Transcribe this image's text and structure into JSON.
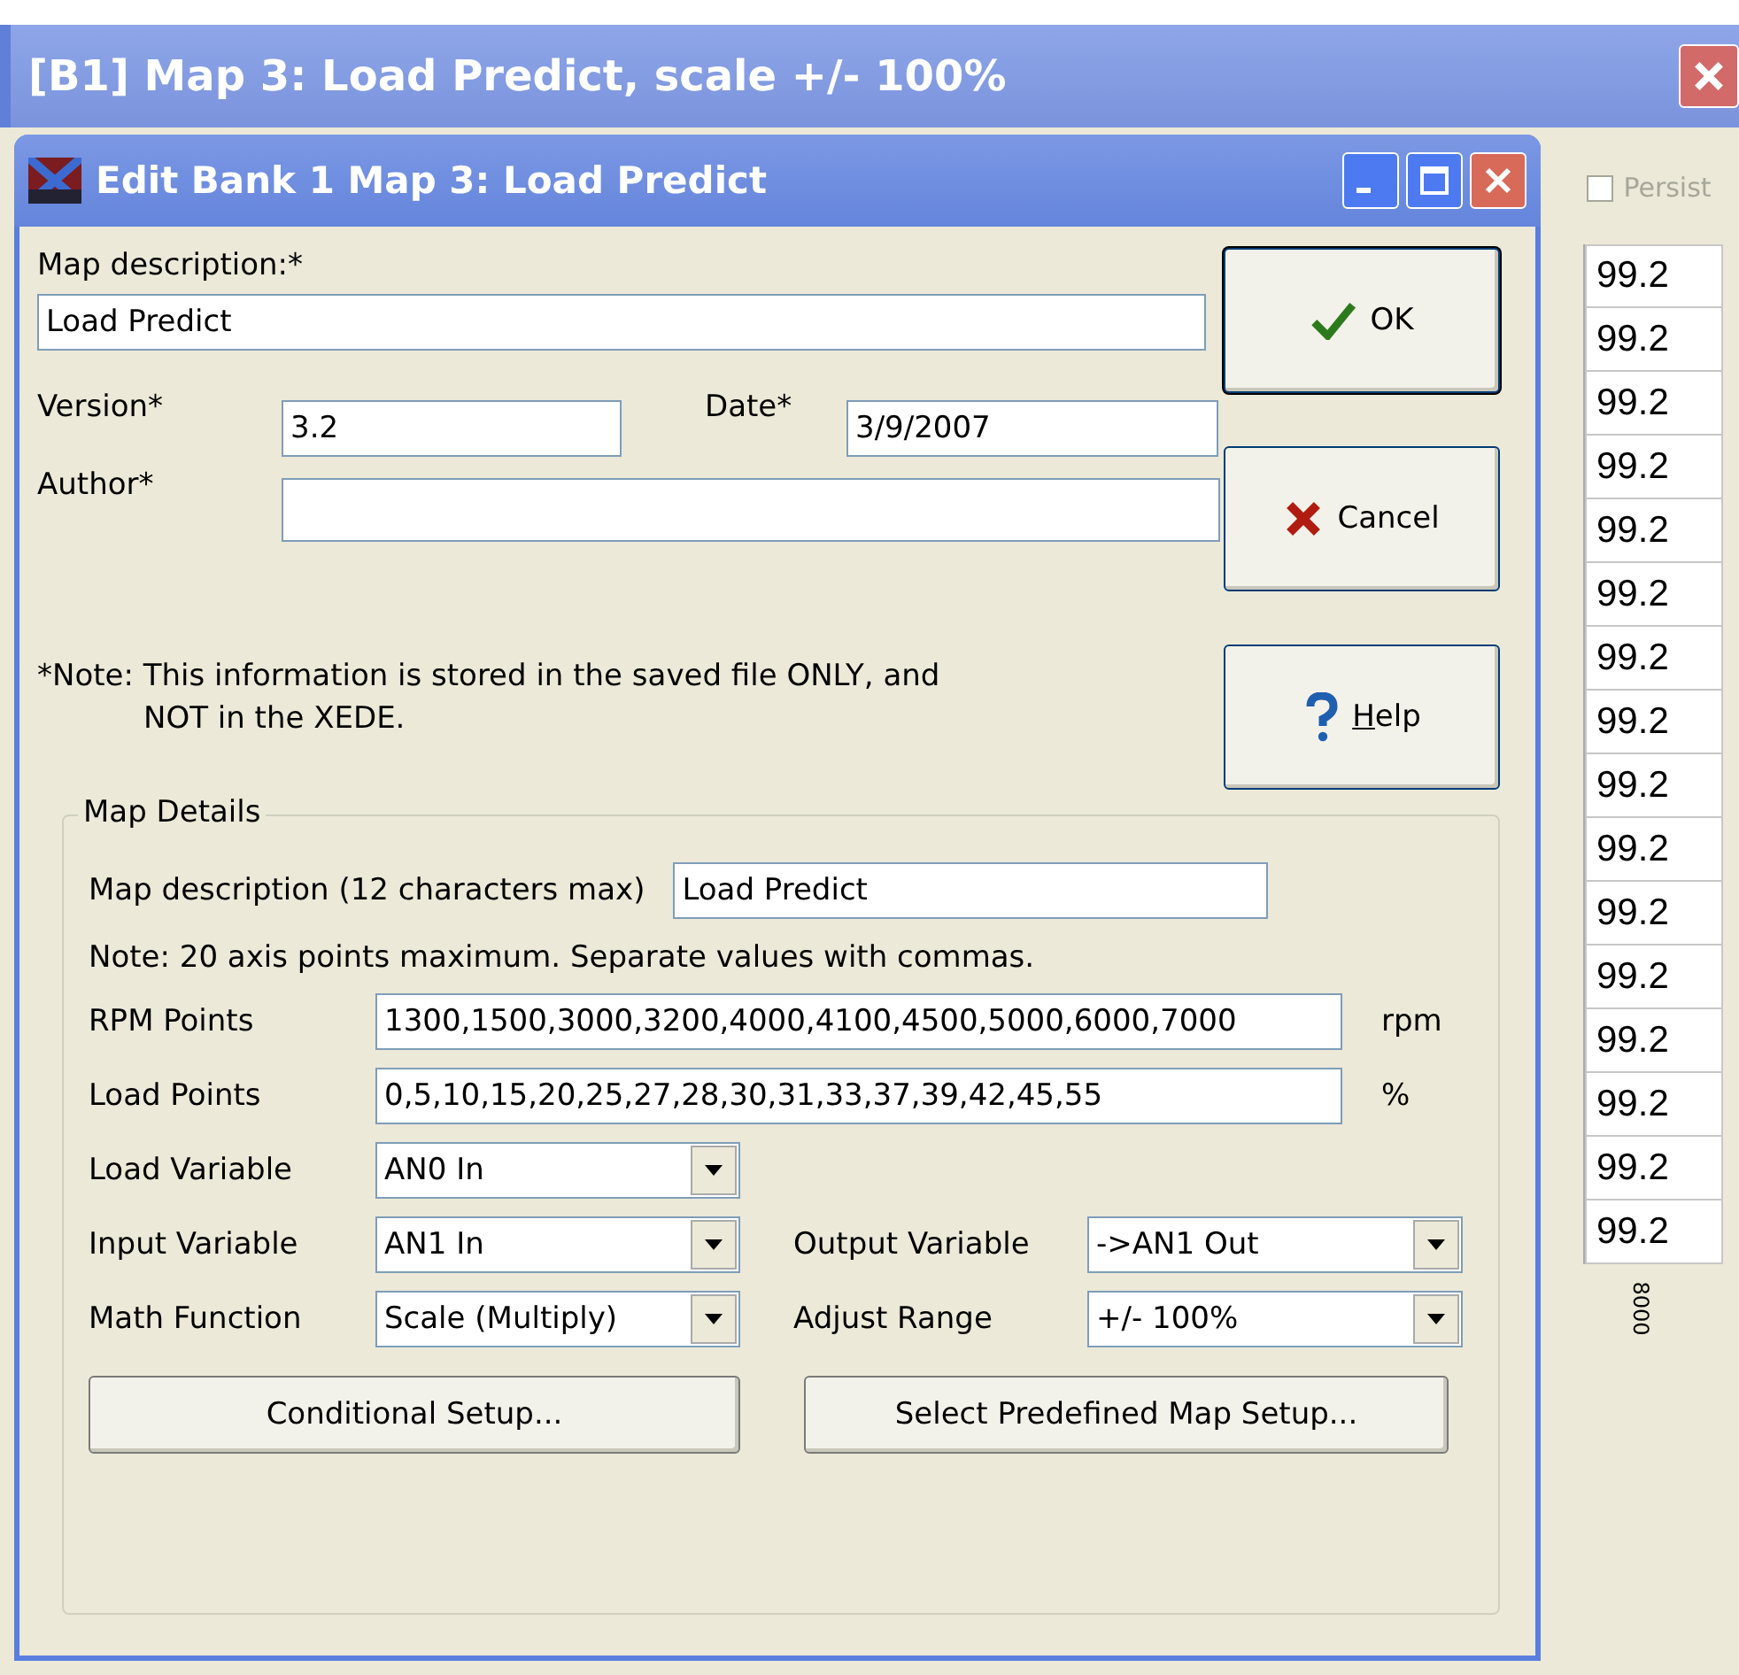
{
  "outer_window": {
    "title": "[B1] Map 3: Load Predict, scale +/- 100%"
  },
  "persist": {
    "label": "Persist",
    "checked": false,
    "disabled": true
  },
  "grid": {
    "cells": [
      "99.2",
      "99.2",
      "99.2",
      "99.2",
      "99.2",
      "99.2",
      "99.2",
      "99.2",
      "99.2",
      "99.2",
      "99.2",
      "99.2",
      "99.2",
      "99.2",
      "99.2",
      "99.2"
    ],
    "axis_label": "8000"
  },
  "dialog": {
    "title": "Edit Bank 1 Map 3: Load Predict",
    "map_description": {
      "label": "Map description:*",
      "value": "Load Predict"
    },
    "version": {
      "label": "Version*",
      "value": "3.2"
    },
    "date": {
      "label": "Date*",
      "value": "3/9/2007"
    },
    "author": {
      "label": "Author*"
    },
    "note_lines": [
      "*Note: This information is stored in the saved file ONLY, and",
      "NOT in the XEDE."
    ],
    "buttons": [
      {
        "kind": "ok",
        "label": "OK"
      },
      {
        "kind": "cancel",
        "label": "Cancel"
      },
      {
        "kind": "help",
        "label": "Help"
      }
    ],
    "map_details": {
      "legend": "Map Details",
      "short_description": {
        "label": "Map description (12 characters max)",
        "value": "Load Predict"
      },
      "axis_note": "Note: 20 axis points maximum.  Separate values with commas.",
      "rpm_points": {
        "label": "RPM Points",
        "value": "1300,1500,3000,3200,4000,4100,4500,5000,6000,7000",
        "unit": "rpm"
      },
      "load_points": {
        "label": "Load Points",
        "value": "0,5,10,15,20,25,27,28,30,31,33,37,39,42,45,55",
        "unit": "%"
      },
      "load_variable": {
        "label": "Load Variable",
        "value": "AN0 In"
      },
      "input_variable": {
        "label": "Input Variable",
        "value": "AN1 In"
      },
      "output_variable": {
        "label": "Output Variable",
        "value": "->AN1 Out"
      },
      "math_function": {
        "label": "Math Function",
        "value": "Scale (Multiply)"
      },
      "adjust_range": {
        "label": "Adjust Range",
        "value": "+/- 100%"
      },
      "setup_buttons": [
        "Conditional Setup...",
        "Select Predefined Map Setup..."
      ]
    }
  }
}
